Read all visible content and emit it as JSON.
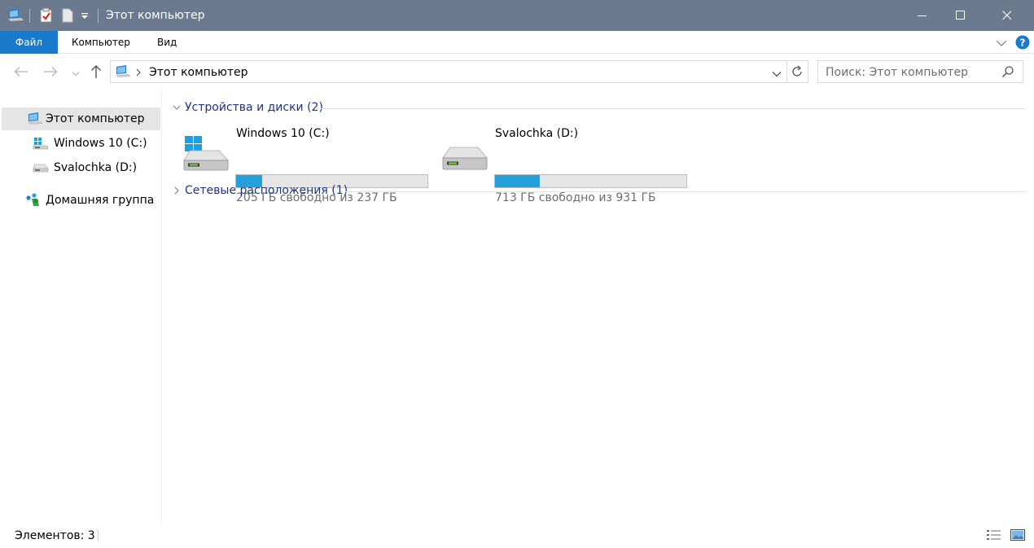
{
  "window": {
    "title": "Этот компьютер"
  },
  "ribbon": {
    "tabs": [
      {
        "label": "Файл"
      },
      {
        "label": "Компьютер"
      },
      {
        "label": "Вид"
      }
    ]
  },
  "address": {
    "path": "Этот компьютер"
  },
  "search": {
    "placeholder": "Поиск: Этот компьютер"
  },
  "sidebar": {
    "items": [
      {
        "label": "Этот компьютер",
        "icon": "computer-icon",
        "selected": true
      },
      {
        "label": "Windows 10 (C:)",
        "icon": "windows-drive-icon"
      },
      {
        "label": "Svalochka (D:)",
        "icon": "drive-icon"
      },
      {
        "label": "Домашняя группа",
        "icon": "homegroup-icon"
      }
    ]
  },
  "groups": [
    {
      "title": "Устройства и диски (2)",
      "expanded": true
    },
    {
      "title": "Сетевые расположения (1)",
      "expanded": false
    }
  ],
  "drives": [
    {
      "name": "Windows 10 (C:)",
      "free_text": "205 ГБ свободно из 237 ГБ",
      "used_fraction": 0.135,
      "icon": "windows-drive-icon"
    },
    {
      "name": "Svalochka (D:)",
      "free_text": "713 ГБ свободно из 931 ГБ",
      "used_fraction": 0.234,
      "icon": "drive-icon"
    }
  ],
  "status": {
    "items_text": "Элементов: 3"
  },
  "colors": {
    "titlebar": "#6b7a8f",
    "file_tab": "#1979ca",
    "bar_fill": "#26a0da",
    "group_title": "#1e3287"
  }
}
